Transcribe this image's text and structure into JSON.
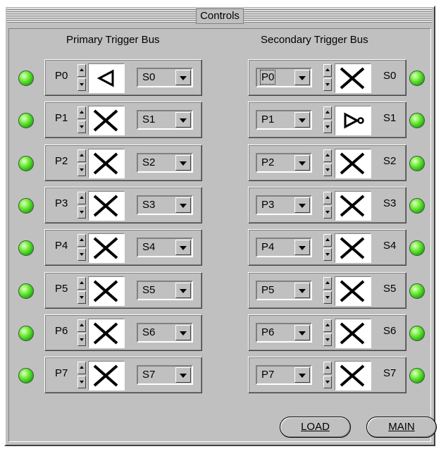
{
  "panel": {
    "title": "Controls"
  },
  "primary": {
    "heading": "Primary Trigger Bus",
    "rows": [
      {
        "label": "P0",
        "symbol": "arrow-left-icon",
        "select": "S0"
      },
      {
        "label": "P1",
        "symbol": "cross-icon",
        "select": "S1"
      },
      {
        "label": "P2",
        "symbol": "cross-icon",
        "select": "S2"
      },
      {
        "label": "P3",
        "symbol": "cross-icon",
        "select": "S3"
      },
      {
        "label": "P4",
        "symbol": "cross-icon",
        "select": "S4"
      },
      {
        "label": "P5",
        "symbol": "cross-icon",
        "select": "S5"
      },
      {
        "label": "P6",
        "symbol": "cross-icon",
        "select": "S6"
      },
      {
        "label": "P7",
        "symbol": "cross-icon",
        "select": "S7"
      }
    ]
  },
  "secondary": {
    "heading": "Secondary Trigger Bus",
    "rows": [
      {
        "label": "S0",
        "symbol": "cross-icon",
        "select": "P0"
      },
      {
        "label": "S1",
        "symbol": "inverter-icon",
        "select": "P1"
      },
      {
        "label": "S2",
        "symbol": "cross-icon",
        "select": "P2"
      },
      {
        "label": "S3",
        "symbol": "cross-icon",
        "select": "P3"
      },
      {
        "label": "S4",
        "symbol": "cross-icon",
        "select": "P4"
      },
      {
        "label": "S5",
        "symbol": "cross-icon",
        "select": "P5"
      },
      {
        "label": "S6",
        "symbol": "cross-icon",
        "select": "P6"
      },
      {
        "label": "S7",
        "symbol": "cross-icon",
        "select": "P7"
      }
    ]
  },
  "buttons": {
    "load": "LOAD",
    "main": "MAIN"
  },
  "colors": {
    "led_on": "#1fa80b",
    "face": "#c0c0c0"
  }
}
